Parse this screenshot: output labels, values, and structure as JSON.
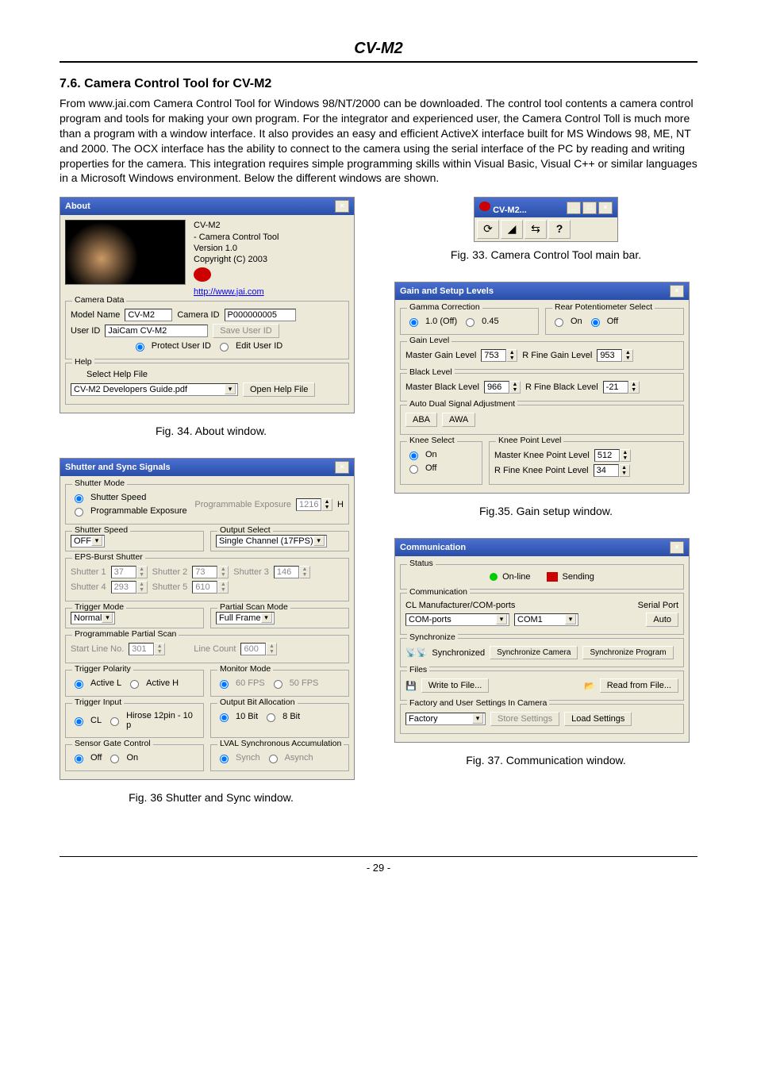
{
  "header": {
    "title": "CV-M2"
  },
  "section": {
    "heading": "7.6. Camera Control Tool for CV-M2",
    "paragraph": "From www.jai.com Camera Control Tool for Windows 98/NT/2000 can be downloaded. The control tool contents a camera control program and tools for making your own program. For the integrator and experienced user, the Camera Control Toll is much more than a program with a window interface. It also provides an easy and efficient ActiveX interface built for MS Windows 98, ME, NT and 2000. The OCX interface has the ability to connect to the camera using the serial interface of the PC by reading and writing properties for the camera. This integration requires simple programming skills within Visual Basic, Visual C++ or similar languages in a Microsoft Windows environment. Below the different windows are shown."
  },
  "about": {
    "title": "About",
    "product": "CV-M2",
    "subtitle": "- Camera Control Tool",
    "version": "Version 1.0",
    "copyright": "Copyright (C) 2003",
    "link": "http://www.jai.com",
    "camera_data": {
      "group": "Camera Data",
      "model_label": "Model Name",
      "model_value": "CV-M2",
      "camera_id_label": "Camera ID",
      "camera_id_value": "P000000005",
      "user_id_label": "User ID",
      "user_id_value": "JaiCam CV-M2",
      "save_btn": "Save User ID",
      "protect_label": "Protect User ID",
      "edit_label": "Edit User ID"
    },
    "help": {
      "group": "Help",
      "select_label": "Select Help File",
      "combo_value": "CV-M2 Developers Guide.pdf",
      "open_btn": "Open Help File"
    },
    "caption": "Fig. 34.  About window."
  },
  "mainbar": {
    "title": "CV-M2...",
    "caption": "Fig. 33. Camera Control Tool main bar."
  },
  "gain": {
    "title": "Gain and Setup Levels",
    "gamma": {
      "group": "Gamma Correction",
      "opt1": "1.0 (Off)",
      "opt2": "0.45"
    },
    "rear": {
      "group": "Rear Potentiometer Select",
      "opt_on": "On",
      "opt_off": "Off"
    },
    "gain_level": {
      "group": "Gain Level",
      "master_label": "Master Gain Level",
      "master_val": "753",
      "rfine_label": "R Fine Gain Level",
      "rfine_val": "953"
    },
    "black": {
      "group": "Black Level",
      "master_label": "Master Black Level",
      "master_val": "966",
      "rfine_label": "R Fine Black Level",
      "rfine_val": "-21"
    },
    "auto": {
      "group": "Auto Dual Signal Adjustment",
      "aba": "ABA",
      "awa": "AWA"
    },
    "knee_select": {
      "group": "Knee Select",
      "on": "On",
      "off": "Off"
    },
    "knee_point": {
      "group": "Knee Point Level",
      "master_label": "Master Knee Point Level",
      "master_val": "512",
      "rfine_label": "R Fine Knee Point Level",
      "rfine_val": "34"
    },
    "caption": "Fig.35. Gain setup window."
  },
  "shutter": {
    "title": "Shutter and Sync Signals",
    "mode": {
      "group": "Shutter Mode",
      "opt1": "Shutter Speed",
      "opt2": "Programmable Exposure",
      "prog_label": "Programmable Exposure",
      "prog_val": "1216",
      "unit": "H"
    },
    "speed": {
      "group": "Shutter Speed",
      "value": "OFF"
    },
    "output": {
      "group": "Output Select",
      "value": "Single Channel (17FPS)"
    },
    "eps": {
      "group": "EPS-Burst Shutter",
      "sh1_label": "Shutter 1",
      "sh1_val": "37",
      "sh2_label": "Shutter 2",
      "sh2_val": "73",
      "sh3_label": "Shutter 3",
      "sh3_val": "146",
      "sh4_label": "Shutter 4",
      "sh4_val": "293",
      "sh5_label": "Shutter 5",
      "sh5_val": "610"
    },
    "trigmode": {
      "group": "Trigger Mode",
      "value": "Normal"
    },
    "partial": {
      "group": "Partial Scan Mode",
      "value": "Full Frame"
    },
    "progscan": {
      "group": "Programmable Partial Scan",
      "start_label": "Start Line No.",
      "start_val": "301",
      "count_label": "Line Count",
      "count_val": "600"
    },
    "polarity": {
      "group": "Trigger Polarity",
      "opt1": "Active L",
      "opt2": "Active H"
    },
    "monitor": {
      "group": "Monitor Mode",
      "opt1": "60 FPS",
      "opt2": "50 FPS"
    },
    "triginput": {
      "group": "Trigger Input",
      "opt1": "CL",
      "opt2": "Hirose 12pin - 10 p"
    },
    "bitalloc": {
      "group": "Output Bit Allocation",
      "opt1": "10 Bit",
      "opt2": "8 Bit"
    },
    "sensor": {
      "group": "Sensor Gate Control",
      "opt_off": "Off",
      "opt_on": "On"
    },
    "lval": {
      "group": "LVAL Synchronous Accumulation",
      "opt1": "Synch",
      "opt2": "Asynch"
    },
    "caption": "Fig. 36 Shutter and Sync window."
  },
  "comm": {
    "title": "Communication",
    "status": {
      "group": "Status",
      "online": "On-line",
      "sending": "Sending"
    },
    "communication": {
      "group": "Communication",
      "cl_label": "CL Manufacturer/COM-ports",
      "serial_label": "Serial Port",
      "ports_label": "COM-ports",
      "com_val": "COM1",
      "auto_btn": "Auto"
    },
    "sync": {
      "group": "Synchronize",
      "label": "Synchronized",
      "btn1": "Synchronize Camera",
      "btn2": "Synchronize Program"
    },
    "files": {
      "group": "Files",
      "write": "Write to File...",
      "read": "Read from File..."
    },
    "factory": {
      "group": "Factory and User Settings In Camera",
      "combo": "Factory",
      "store": "Store Settings",
      "load": "Load Settings"
    },
    "caption": "Fig. 37. Communication window."
  },
  "footer": {
    "page": "- 29 -"
  }
}
